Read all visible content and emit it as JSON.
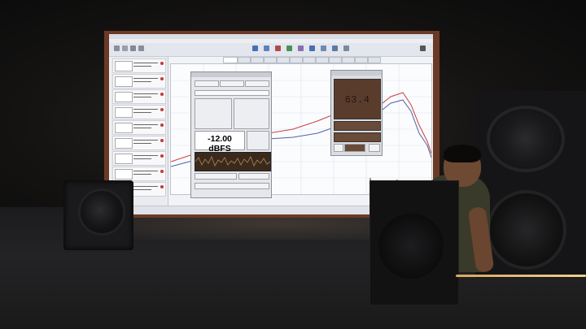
{
  "scene": {
    "description_elements": [
      "projection-screen",
      "subwoofer-left",
      "speaker-right",
      "speaker-center",
      "person"
    ]
  },
  "app": {
    "menu_items": [
      "File",
      "Tools",
      "Preferences",
      "Help"
    ],
    "tabs": [
      "All SPL",
      "SPL & Phase",
      "Impulse",
      "RT60",
      "Spectrogram"
    ],
    "measurements": [
      {
        "name": "Measurement 1"
      },
      {
        "name": "Measurement 2"
      },
      {
        "name": "Measurement 3"
      },
      {
        "name": "Measurement 4"
      },
      {
        "name": "Measurement 5"
      },
      {
        "name": "Measurement 6"
      },
      {
        "name": "Measurement 7"
      },
      {
        "name": "Measurement 8"
      },
      {
        "name": "Measurement 9"
      }
    ],
    "generator": {
      "level": "-12.00 dBFS"
    },
    "spl_meter": {
      "reading": "63.4"
    }
  },
  "colors": {
    "screen_frame": "#6b3a26",
    "trace_red": "#c84040",
    "trace_blue": "#5060a8",
    "cable": "#e0b870"
  }
}
